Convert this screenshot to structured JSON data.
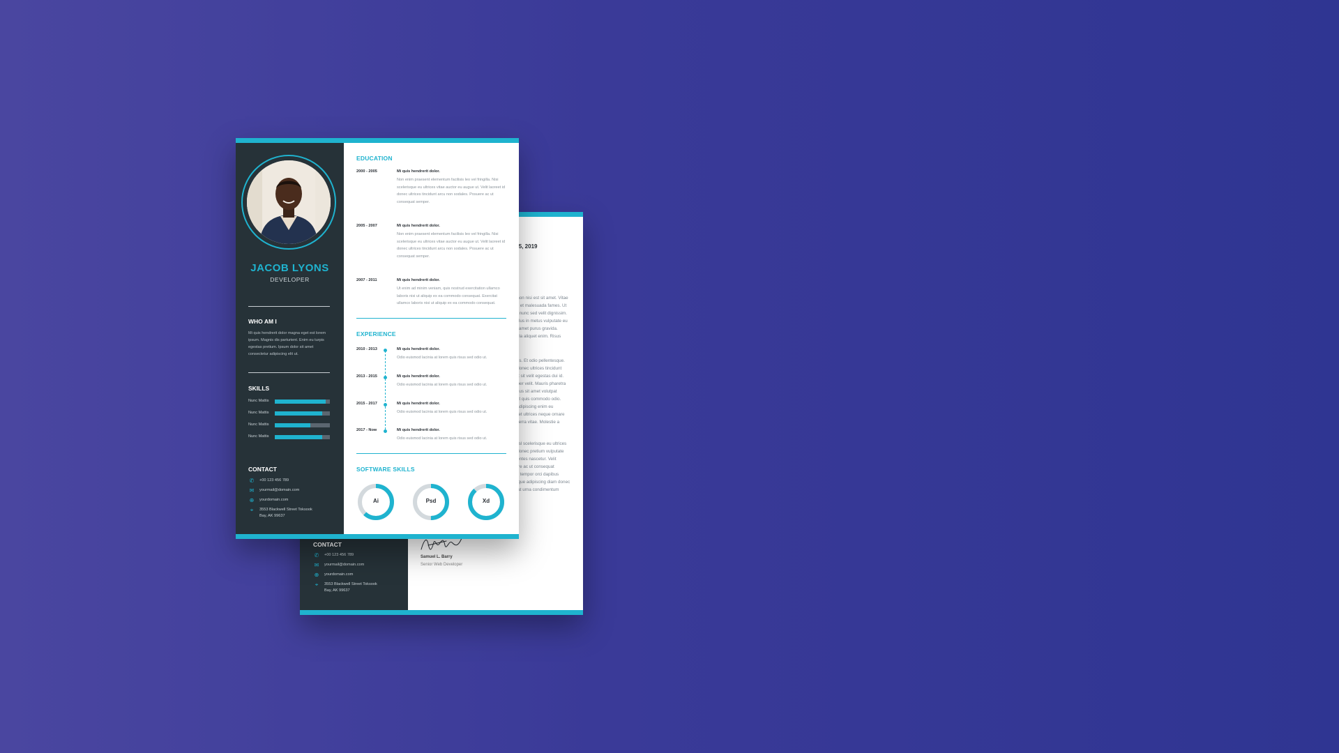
{
  "colors": {
    "accent": "#1fb3cf",
    "sidebar": "#263238",
    "background": "#3a3a98"
  },
  "cover_letter": {
    "date": "r 25, 2019",
    "paragraph1": ".. non nisi est sit amet. Vitae\nais et malesuada fames. Ut\nae nunc sed velit dignissim.\nTellus in metus vulputate eu\nsit amet purus gravida.\nnulla aliquet enim. Risus",
    "paragraph2": "attis. Et odio pellentesque.\nd donec ultrices tincidunt\nuat sit velit egestas dui id.\norper velit. Mauris pharetra\nlunus sit amet volutpat\nabit quis commodo odio.\nn adipiscing enim eu\nra et ultrices neque ornare\nviverra vitae. Molestie a",
    "paragraph3": " Nisl scelerisque eu ultrices\nd donec pretium vulputate\nmentes nascetur. Velit\nuere ac ut consequat\nelit tempor orci dapibus\nusque adipiscing diam donec\nlit at urna condimentum",
    "signature_name": "Samuel L. Barry",
    "signature_role": "Senior Web Developer",
    "contact": {
      "heading": "CONTACT",
      "phone": "+00 123 456 789",
      "email": "yourmail@domain.com",
      "website": "yourdomain.com",
      "address": "3553 Blackwell Street Toksook\nBay, AK 99637"
    }
  },
  "resume": {
    "name": "JACOB LYONS",
    "role": "DEVELOPER",
    "about": {
      "heading": "WHO AM I",
      "text": "Mi quis hendrerit dolor magna eget est lorem ipsum. Magnis dis parturient. Enim eu turpis egestas pretium. Ipsum dolor sit amet consectetur adipiscing elit ut."
    },
    "skills": {
      "heading": "SKILLS",
      "items": [
        {
          "label": "Nunc Mattis",
          "level": 0.92
        },
        {
          "label": "Nunc Mattis",
          "level": 0.86
        },
        {
          "label": "Nunc Mattis",
          "level": 0.64
        },
        {
          "label": "Nunc Mattis",
          "level": 0.86
        }
      ]
    },
    "contact": {
      "heading": "CONTACT",
      "phone": "+00 123 456 789",
      "email": "yourmail@domain.com",
      "website": "yourdomain.com",
      "address": "3553 Blackwell Street Toksook\nBay, AK 99637"
    },
    "education": {
      "heading": "EDUCATION",
      "items": [
        {
          "years": "2000 - 2005",
          "title": "Mi quis hendrerit dolor.",
          "text": "Non enim praesent elementum facilisis leo vel fringilla. Nisi scelerisque eu ultrices vitae auctor eu augue ut. Velit laoreet id donec ultrices tincidunt arcu non sodales. Posuere ac ut consequat semper."
        },
        {
          "years": "2005 - 2007",
          "title": "Mi quis hendrerit dolor.",
          "text": "Non enim praesent elementum facilisis leo vel fringilla. Nisi scelerisque eu ultrices vitae auctor eu augue ut. Velit laoreet id donec ultrices tincidunt arcu non sodales. Posuere ac ut consequat semper."
        },
        {
          "years": "2007 - 2011",
          "title": "Mi quis hendrerit dolor.",
          "text": "Ut enim ad minim veniam, quis nostrud exercitation ullamco laboris nisi ut aliquip ex ea commodo consequat. Exercitat ullamco laboris nisi ut aliquip ex ea commodo consequat."
        }
      ]
    },
    "experience": {
      "heading": "EXPERIENCE",
      "items": [
        {
          "years": "2010 - 2013",
          "title": "Mi quis hendrerit dolor.",
          "text": "Odio euismod lacinia at lorem quis risus sed odio ut."
        },
        {
          "years": "2013 - 2015",
          "title": "Mi quis hendrerit dolor.",
          "text": "Odio euismod lacinia at lorem quis risus sed odio ut."
        },
        {
          "years": "2015 - 2017",
          "title": "Mi quis hendrerit dolor.",
          "text": "Odio euismod lacinia at lorem quis risus sed odio ut."
        },
        {
          "years": "2017 - Now",
          "title": "Mi quis hendrerit dolor.",
          "text": "Odio euismod lacinia at lorem quis risus sed odio ut."
        }
      ]
    },
    "software": {
      "heading": "SOFTWARE SKILLS",
      "items": [
        {
          "label": "Ai",
          "level": 0.62
        },
        {
          "label": "Psd",
          "level": 0.5
        },
        {
          "label": "Xd",
          "level": 0.88
        }
      ]
    }
  }
}
